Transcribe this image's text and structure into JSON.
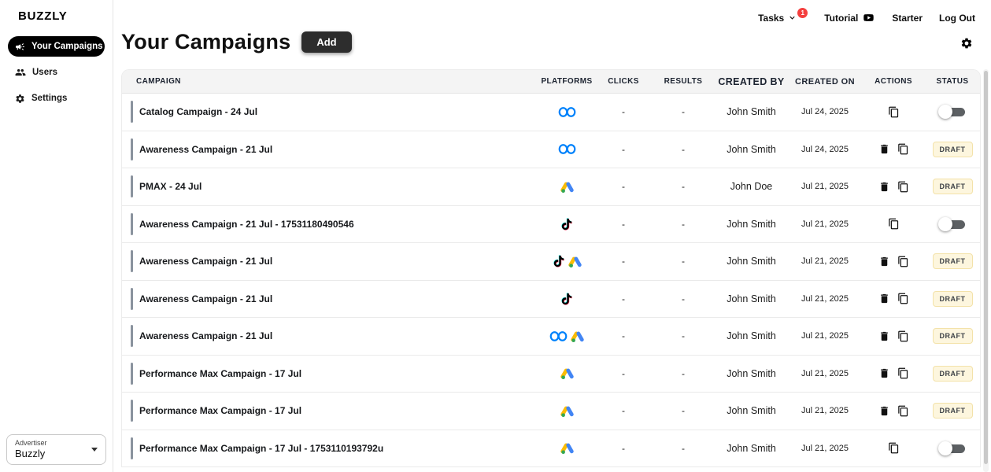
{
  "brand": {
    "logo": "BUZZLY"
  },
  "sidebar": {
    "nav": [
      {
        "label": "Your Campaigns",
        "icon": "megaphone-icon",
        "active": true
      },
      {
        "label": "Users",
        "icon": "users-icon",
        "active": false
      },
      {
        "label": "Settings",
        "icon": "gear-icon",
        "active": false
      }
    ],
    "advertiser_selector": {
      "label": "Advertiser",
      "value": "Buzzly"
    }
  },
  "topbar": {
    "tasks": {
      "label": "Tasks",
      "badge_count": "1"
    },
    "tutorial": {
      "label": "Tutorial",
      "icon": "youtube-icon"
    },
    "plan": "Starter",
    "logout": "Log Out"
  },
  "main": {
    "title": "Your Campaigns",
    "add_button": "Add"
  },
  "table": {
    "columns": [
      "CAMPAIGN",
      "PLATFORMS",
      "CLICKS",
      "RESULTS",
      "CREATED BY",
      "CREATED ON",
      "ACTIONS",
      "STATUS"
    ],
    "rows": [
      {
        "name": "Catalog Campaign - 24 Jul",
        "platforms": [
          "meta"
        ],
        "clicks": "-",
        "results": "-",
        "created_by": "John Smith",
        "created_on": "Jul 24, 2025",
        "actions": [
          "duplicate"
        ],
        "status": {
          "type": "toggle",
          "state": "off"
        }
      },
      {
        "name": "Awareness Campaign - 21 Jul",
        "platforms": [
          "meta"
        ],
        "clicks": "-",
        "results": "-",
        "created_by": "John Smith",
        "created_on": "Jul 24, 2025",
        "actions": [
          "delete",
          "duplicate"
        ],
        "status": {
          "type": "badge",
          "label": "DRAFT"
        }
      },
      {
        "name": "PMAX - 24 Jul",
        "platforms": [
          "google"
        ],
        "clicks": "-",
        "results": "-",
        "created_by": "John Doe",
        "created_on": "Jul 21, 2025",
        "actions": [
          "delete",
          "duplicate"
        ],
        "status": {
          "type": "badge",
          "label": "DRAFT"
        }
      },
      {
        "name": "Awareness Campaign - 21 Jul - 17531180490546",
        "platforms": [
          "tiktok"
        ],
        "clicks": "-",
        "results": "-",
        "created_by": "John Smith",
        "created_on": "Jul 21, 2025",
        "actions": [
          "duplicate"
        ],
        "status": {
          "type": "toggle",
          "state": "off"
        }
      },
      {
        "name": "Awareness Campaign - 21 Jul",
        "platforms": [
          "tiktok",
          "google"
        ],
        "clicks": "-",
        "results": "-",
        "created_by": "John Smith",
        "created_on": "Jul 21, 2025",
        "actions": [
          "delete",
          "duplicate"
        ],
        "status": {
          "type": "badge",
          "label": "DRAFT"
        }
      },
      {
        "name": "Awareness Campaign - 21 Jul",
        "platforms": [
          "tiktok"
        ],
        "clicks": "-",
        "results": "-",
        "created_by": "John Smith",
        "created_on": "Jul 21, 2025",
        "actions": [
          "delete",
          "duplicate"
        ],
        "status": {
          "type": "badge",
          "label": "DRAFT"
        }
      },
      {
        "name": "Awareness Campaign - 21 Jul",
        "platforms": [
          "meta",
          "google"
        ],
        "clicks": "-",
        "results": "-",
        "created_by": "John Smith",
        "created_on": "Jul 21, 2025",
        "actions": [
          "delete",
          "duplicate"
        ],
        "status": {
          "type": "badge",
          "label": "DRAFT"
        }
      },
      {
        "name": "Performance Max Campaign - 17 Jul",
        "platforms": [
          "google"
        ],
        "clicks": "-",
        "results": "-",
        "created_by": "John Smith",
        "created_on": "Jul 21, 2025",
        "actions": [
          "delete",
          "duplicate"
        ],
        "status": {
          "type": "badge",
          "label": "DRAFT"
        }
      },
      {
        "name": "Performance Max Campaign - 17 Jul",
        "platforms": [
          "google"
        ],
        "clicks": "-",
        "results": "-",
        "created_by": "John Smith",
        "created_on": "Jul 21, 2025",
        "actions": [
          "delete",
          "duplicate"
        ],
        "status": {
          "type": "badge",
          "label": "DRAFT"
        }
      },
      {
        "name": "Performance Max Campaign - 17 Jul - 1753110193792u",
        "platforms": [
          "google"
        ],
        "clicks": "-",
        "results": "-",
        "created_by": "John Smith",
        "created_on": "Jul 21, 2025",
        "actions": [
          "duplicate"
        ],
        "status": {
          "type": "toggle",
          "state": "off"
        }
      }
    ]
  },
  "colors": {
    "meta_blue": "#0082fb",
    "google_blue": "#4285f4",
    "google_yellow": "#fbbc04",
    "google_green": "#34a853",
    "tiktok_cyan": "#25f4ee",
    "tiktok_red": "#fe2c55",
    "tasks_badge_red": "#f43f3e",
    "draft_bg": "#fdf6de",
    "draft_border": "#f3e2a9",
    "active_nav_bg": "#000000"
  }
}
